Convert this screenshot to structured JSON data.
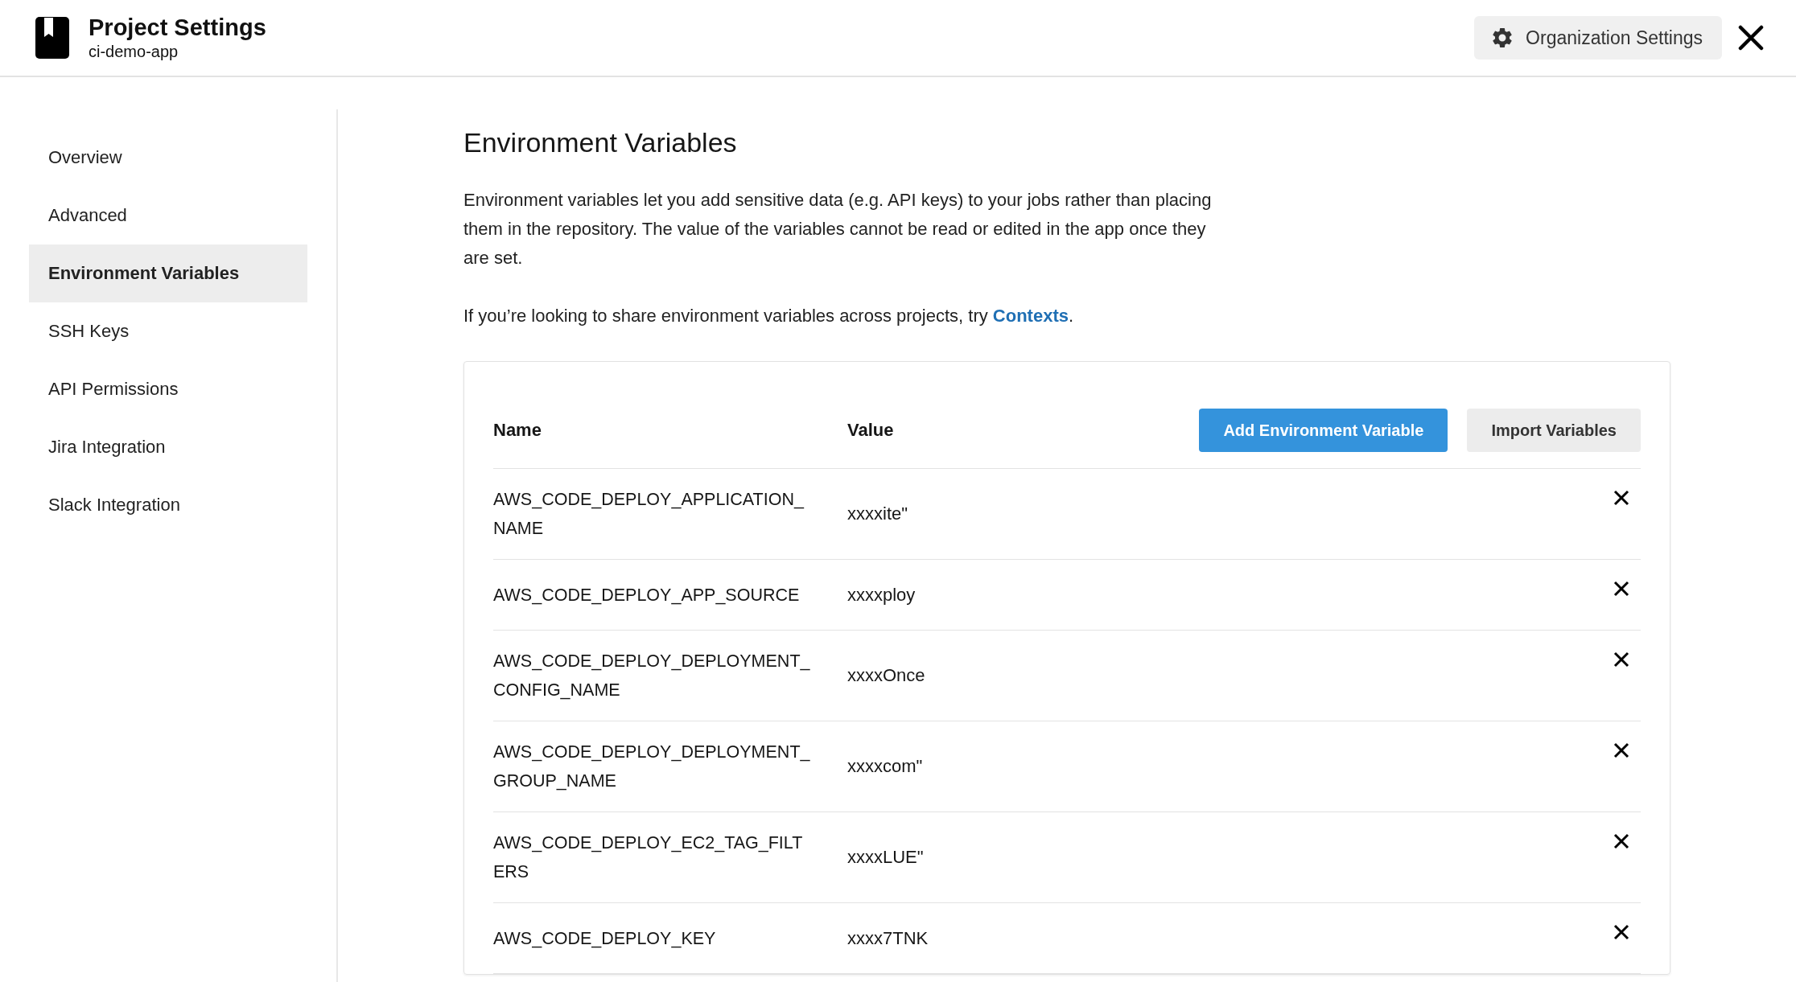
{
  "header": {
    "title": "Project Settings",
    "subtitle": "ci-demo-app",
    "org_button": "Organization Settings"
  },
  "sidebar": {
    "items": [
      {
        "label": "Overview",
        "selected": false
      },
      {
        "label": "Advanced",
        "selected": false
      },
      {
        "label": "Environment Variables",
        "selected": true
      },
      {
        "label": "SSH Keys",
        "selected": false
      },
      {
        "label": "API Permissions",
        "selected": false
      },
      {
        "label": "Jira Integration",
        "selected": false
      },
      {
        "label": "Slack Integration",
        "selected": false
      }
    ]
  },
  "content": {
    "title": "Environment Variables",
    "description": "Environment variables let you add sensitive data (e.g. API keys) to your jobs rather than placing them in the repository. The value of the variables cannot be read or edited in the app once they are set.",
    "share_text": "If you’re looking to share environment variables across projects, try ",
    "share_link": "Contexts",
    "share_end": "."
  },
  "table": {
    "columns": [
      "Name",
      "Value"
    ],
    "add_button": "Add Environment Variable",
    "import_button": "Import Variables",
    "rows": [
      {
        "name": "AWS_CODE_DEPLOY_APPLICATION_NAME",
        "value": "xxxxite\""
      },
      {
        "name": "AWS_CODE_DEPLOY_APP_SOURCE",
        "value": "xxxxploy"
      },
      {
        "name": "AWS_CODE_DEPLOY_DEPLOYMENT_CONFIG_NAME",
        "value": "xxxxOnce"
      },
      {
        "name": "AWS_CODE_DEPLOY_DEPLOYMENT_GROUP_NAME",
        "value": "xxxxcom\""
      },
      {
        "name": "AWS_CODE_DEPLOY_EC2_TAG_FILTERS",
        "value": "xxxxLUE\""
      },
      {
        "name": "AWS_CODE_DEPLOY_KEY",
        "value": "xxxx7TNK"
      }
    ]
  }
}
